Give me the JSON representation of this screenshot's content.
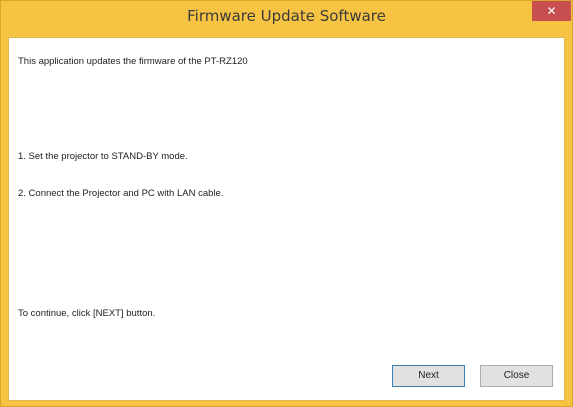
{
  "window": {
    "title": "Firmware Update Software",
    "close_glyph": "✕"
  },
  "content": {
    "intro_prefix": "This application updates the firmware of the",
    "model": "PT-RZ120",
    "step1": "1. Set the projector to STAND-BY mode.",
    "step2": "2. Connect the Projector and PC with LAN cable.",
    "continue_text": "To continue, click [NEXT] button."
  },
  "buttons": {
    "next_label": "Next",
    "close_label": "Close"
  },
  "colors": {
    "frame": "#f6c342",
    "close_button": "#c74f4f",
    "default_button_border": "#3c7fb1"
  }
}
